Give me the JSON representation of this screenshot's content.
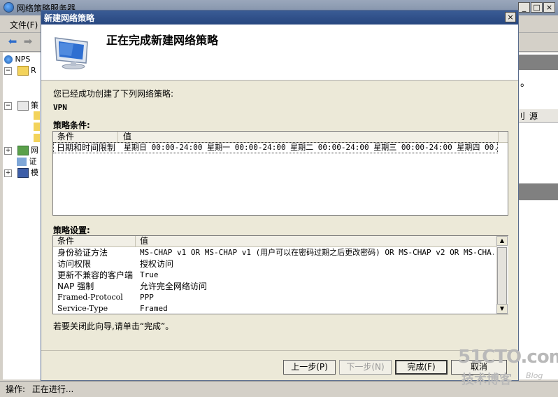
{
  "background_window": {
    "title": "网络策略服务器",
    "menu_file": "文件(F)",
    "tree": {
      "nps_label": "NPS",
      "row_r": "R",
      "row_policy": "策",
      "row_w": "网",
      "row_c": "证",
      "row_m": "模"
    },
    "right_pane": {
      "col1": "刂",
      "col2": "源",
      "marker": "。"
    },
    "status": {
      "label": "操作:",
      "value": "正在进行..."
    }
  },
  "dialog": {
    "title": "新建网络策略",
    "heading": "正在完成新建网络策略",
    "success_text": "您已经成功创建了下列网络策略:",
    "policy_name": "VPN",
    "conditions": {
      "label": "策略条件:",
      "headers": [
        "条件",
        "值"
      ],
      "rows": [
        {
          "condition": "日期和时间限制",
          "value": "星期日 00:00-24:00 星期一 00:00-24:00 星期二 00:00-24:00 星期三 00:00-24:00 星期四 00..."
        }
      ]
    },
    "settings": {
      "label": "策略设置:",
      "headers": [
        "条件",
        "值"
      ],
      "rows": [
        {
          "condition": "身份验证方法",
          "value": "MS-CHAP v1 OR MS-CHAP v1 (用户可以在密码过期之后更改密码) OR MS-CHAP v2 OR MS-CHA..."
        },
        {
          "condition": "访问权限",
          "value": "授权访问"
        },
        {
          "condition": "更新不兼容的客户端",
          "value": "True"
        },
        {
          "condition": "NAP 强制",
          "value": "允许完全网络访问"
        },
        {
          "condition": "Framed-Protocol",
          "value": "PPP"
        },
        {
          "condition": "Service-Type",
          "value": "Framed"
        }
      ]
    },
    "close_hint": "若要关闭此向导,请单击“完成”。",
    "buttons": {
      "back": "上一步(P)",
      "next": "下一步(N)",
      "finish": "完成(F)",
      "cancel": "取消"
    },
    "close_glyph": "×"
  },
  "watermark": {
    "site": "51CTO.com",
    "sub": "技术博客",
    "blog": "Blog"
  },
  "icons": {
    "app": "nps-globe-icon",
    "monitor": "monitor-icon",
    "back": "back-arrow-icon",
    "forward": "forward-arrow-icon"
  },
  "colors": {
    "dialog_titlebar": "#27467f",
    "background_titlebar": "#7f8fa7",
    "dialog_face": "#ece9d8"
  }
}
